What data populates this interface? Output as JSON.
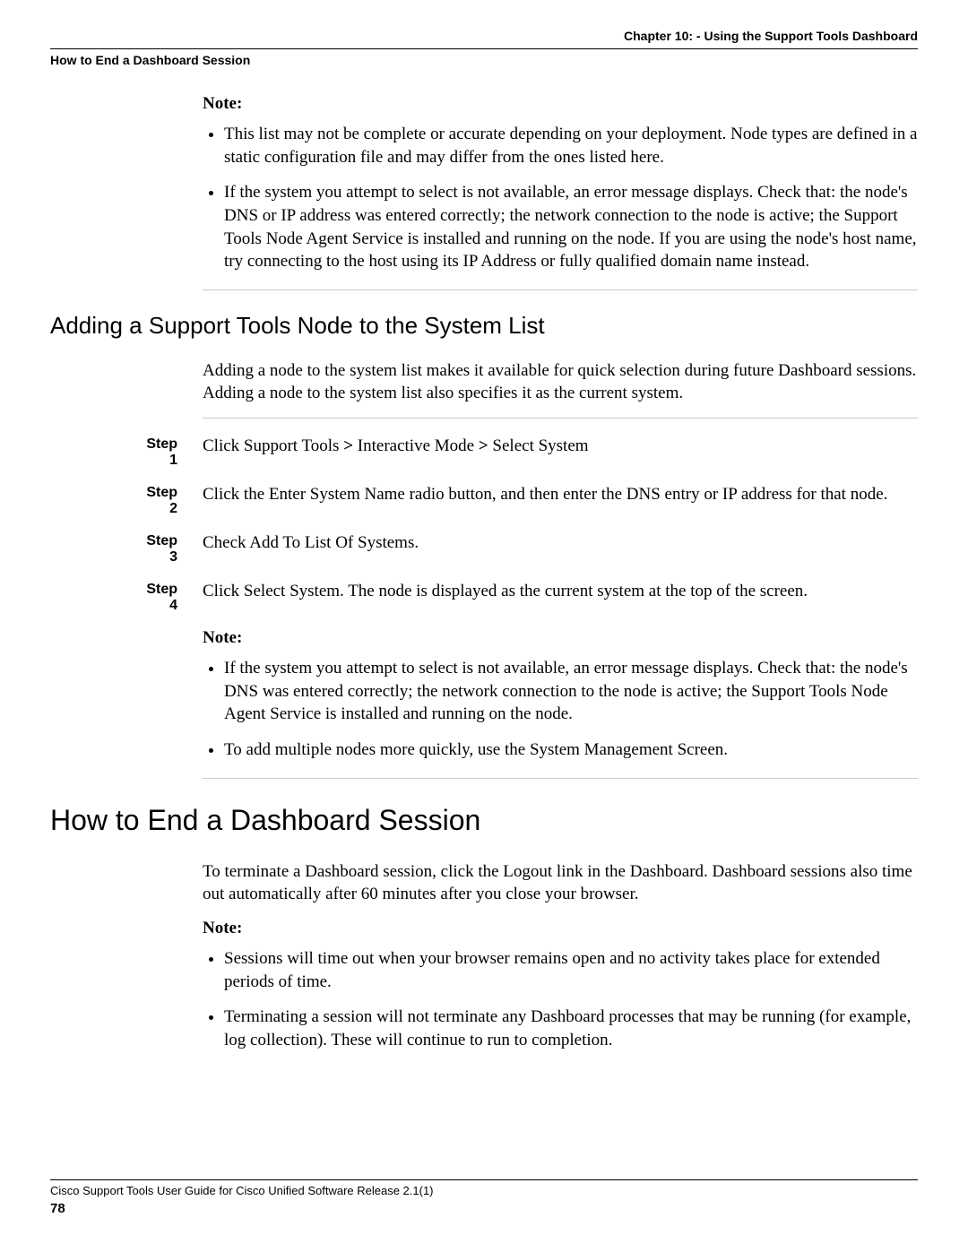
{
  "header": {
    "chapter_line": "Chapter 10: - Using the Support Tools Dashboard",
    "subhead": "How to End a Dashboard Session"
  },
  "note1": {
    "label": "Note:",
    "bullets": [
      "This list may not be complete or accurate depending on your deployment. Node types are defined in a static configuration file and may differ from the ones listed here.",
      "If the system you attempt to select is not available, an error message displays. Check that: the node's DNS or IP address was entered correctly; the network connection to the node is active; the Support Tools Node Agent Service is installed and running on the node. If you are using the node's host name, try connecting to the host using its IP Address or fully qualified domain name instead."
    ]
  },
  "section_add": {
    "heading": "Adding a Support Tools Node to the System List",
    "intro": "Adding a node to the system list makes it available for quick selection during future Dashboard sessions. Adding a node to the system list also specifies it as the current system."
  },
  "steps": [
    {
      "label": "Step 1",
      "prefix": "Click Support Tools ",
      "mid1": "Interactive Mode",
      "mid2": "Select System",
      "rest": ""
    },
    {
      "label": "Step 2",
      "text": "Click the Enter System Name radio button, and then enter the DNS entry or IP address for that node."
    },
    {
      "label": "Step 3",
      "text": "Check Add To List Of Systems."
    },
    {
      "label": "Step 4",
      "text": "Click Select System. The node is displayed as the current system at the top of the screen."
    }
  ],
  "note2": {
    "label": "Note:",
    "bullets": [
      "If the system you attempt to select is not available, an error message displays. Check that: the node's DNS was entered correctly; the network connection to the node is active; the Support Tools Node Agent Service is installed and running on the node.",
      "To add multiple nodes more quickly, use the System Management Screen."
    ]
  },
  "section_end": {
    "heading": "How to End a Dashboard Session",
    "intro": "To terminate a Dashboard session, click the Logout link in the Dashboard. Dashboard sessions also time out automatically after 60 minutes after you close your browser."
  },
  "note3": {
    "label": "Note:",
    "bullets": [
      "Sessions will time out when your browser remains open and no activity takes place for extended periods of time.",
      "Terminating a session will not terminate any Dashboard processes that may be running (for example, log collection). These will continue to run to completion."
    ]
  },
  "footer": {
    "title": "Cisco Support Tools User Guide for Cisco Unified Software Release 2.1(1)",
    "page": "78"
  },
  "glyphs": {
    "arrow": ">"
  }
}
